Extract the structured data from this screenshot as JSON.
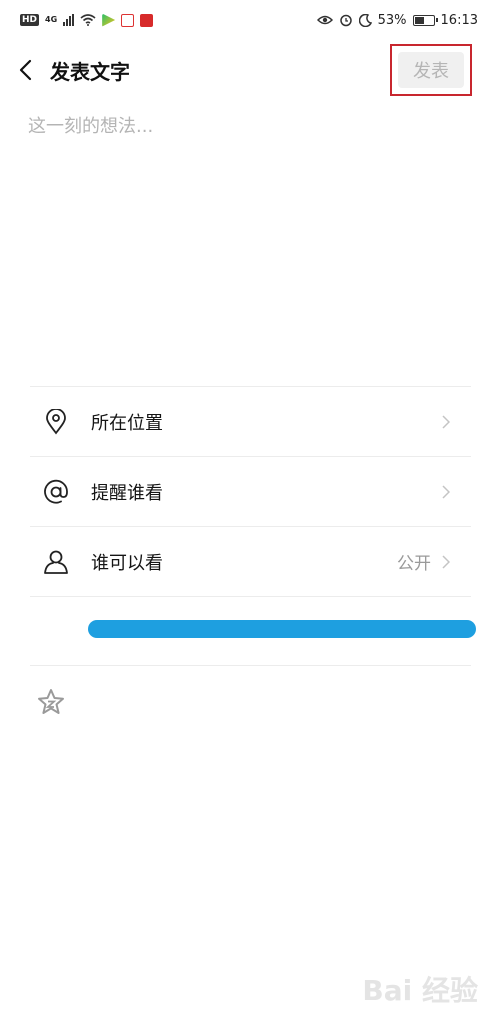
{
  "status_bar": {
    "hd": "HD",
    "network": "4G",
    "battery_pct": "53%",
    "battery_level": 0.53,
    "time": "16:13",
    "icons": [
      "signal-icon",
      "wifi-icon",
      "eye-icon",
      "alarm-icon",
      "moon-icon",
      "battery-icon"
    ]
  },
  "header": {
    "title": "发表文字",
    "publish_label": "发表",
    "back_icon": "back-chevron-icon"
  },
  "compose": {
    "placeholder": "这一刻的想法..."
  },
  "options": [
    {
      "icon": "location-pin-icon",
      "label": "所在位置",
      "value": ""
    },
    {
      "icon": "at-icon",
      "label": "提醒谁看",
      "value": ""
    },
    {
      "icon": "person-icon",
      "label": "谁可以看",
      "value": "公开"
    }
  ],
  "watermark": "Bai 经验",
  "colors": {
    "highlight_border": "#c8262e",
    "redaction": "#1e9fe0",
    "publish_disabled_bg": "#f0f0f0",
    "publish_disabled_text": "#b5b5b5"
  }
}
